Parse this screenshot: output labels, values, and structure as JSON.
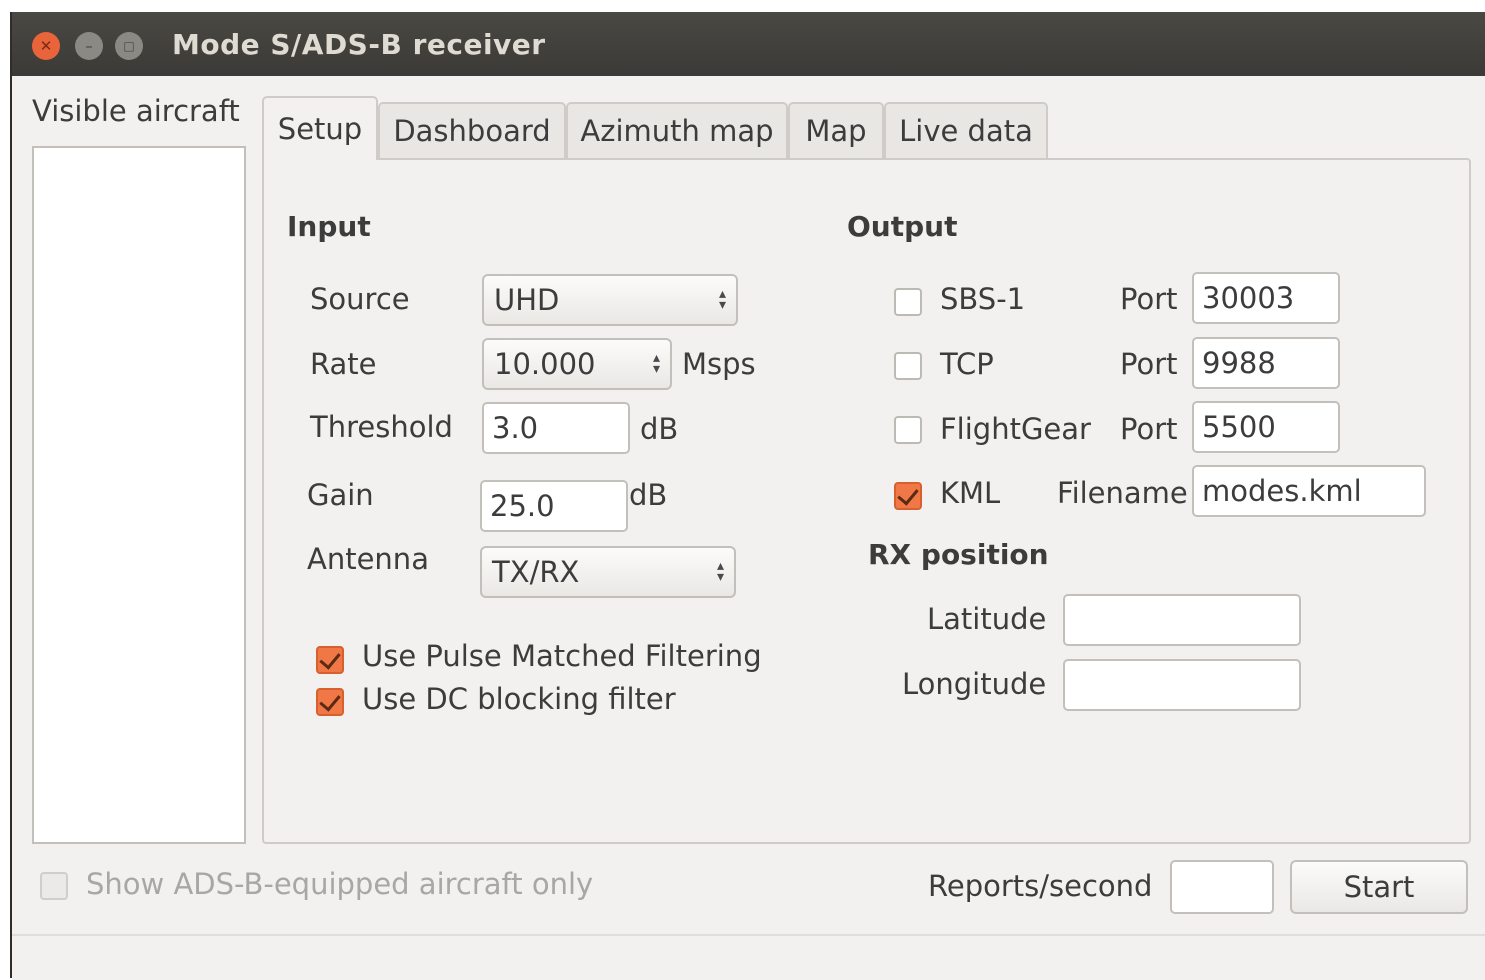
{
  "window": {
    "title": "Mode S/ADS-B receiver"
  },
  "sidebar": {
    "label": "Visible aircraft"
  },
  "tabs": [
    {
      "label": "Setup",
      "active": true
    },
    {
      "label": "Dashboard",
      "active": false
    },
    {
      "label": "Azimuth map",
      "active": false
    },
    {
      "label": "Map",
      "active": false
    },
    {
      "label": "Live data",
      "active": false
    }
  ],
  "input": {
    "heading": "Input",
    "source": {
      "label": "Source",
      "value": "UHD"
    },
    "rate": {
      "label": "Rate",
      "value": "10.000",
      "unit": "Msps"
    },
    "threshold": {
      "label": "Threshold",
      "value": "3.0",
      "unit": "dB"
    },
    "gain": {
      "label": "Gain",
      "value": "25.0",
      "unit": "dB"
    },
    "antenna": {
      "label": "Antenna",
      "value": "TX/RX"
    },
    "pulse_filter": {
      "label": "Use Pulse Matched Filtering",
      "checked": true
    },
    "dc_filter": {
      "label": "Use DC blocking filter",
      "checked": true
    }
  },
  "output": {
    "heading": "Output",
    "sbs1": {
      "label": "SBS-1",
      "checked": false,
      "port_label": "Port",
      "port": "30003"
    },
    "tcp": {
      "label": "TCP",
      "checked": false,
      "port_label": "Port",
      "port": "9988"
    },
    "flightgear": {
      "label": "FlightGear",
      "checked": false,
      "port_label": "Port",
      "port": "5500"
    },
    "kml": {
      "label": "KML",
      "checked": true,
      "file_label": "Filename",
      "filename": "modes.kml"
    }
  },
  "rx_position": {
    "heading": "RX position",
    "latitude": {
      "label": "Latitude",
      "value": ""
    },
    "longitude": {
      "label": "Longitude",
      "value": ""
    }
  },
  "footer": {
    "ads_only_label": "Show ADS-B-equipped aircraft only",
    "ads_only_checked": false,
    "reports_label": "Reports/second",
    "reports_value": "",
    "start_label": "Start"
  },
  "colors": {
    "accent": "#f07746",
    "titlebar": "#3c3b37",
    "close": "#e95420"
  }
}
